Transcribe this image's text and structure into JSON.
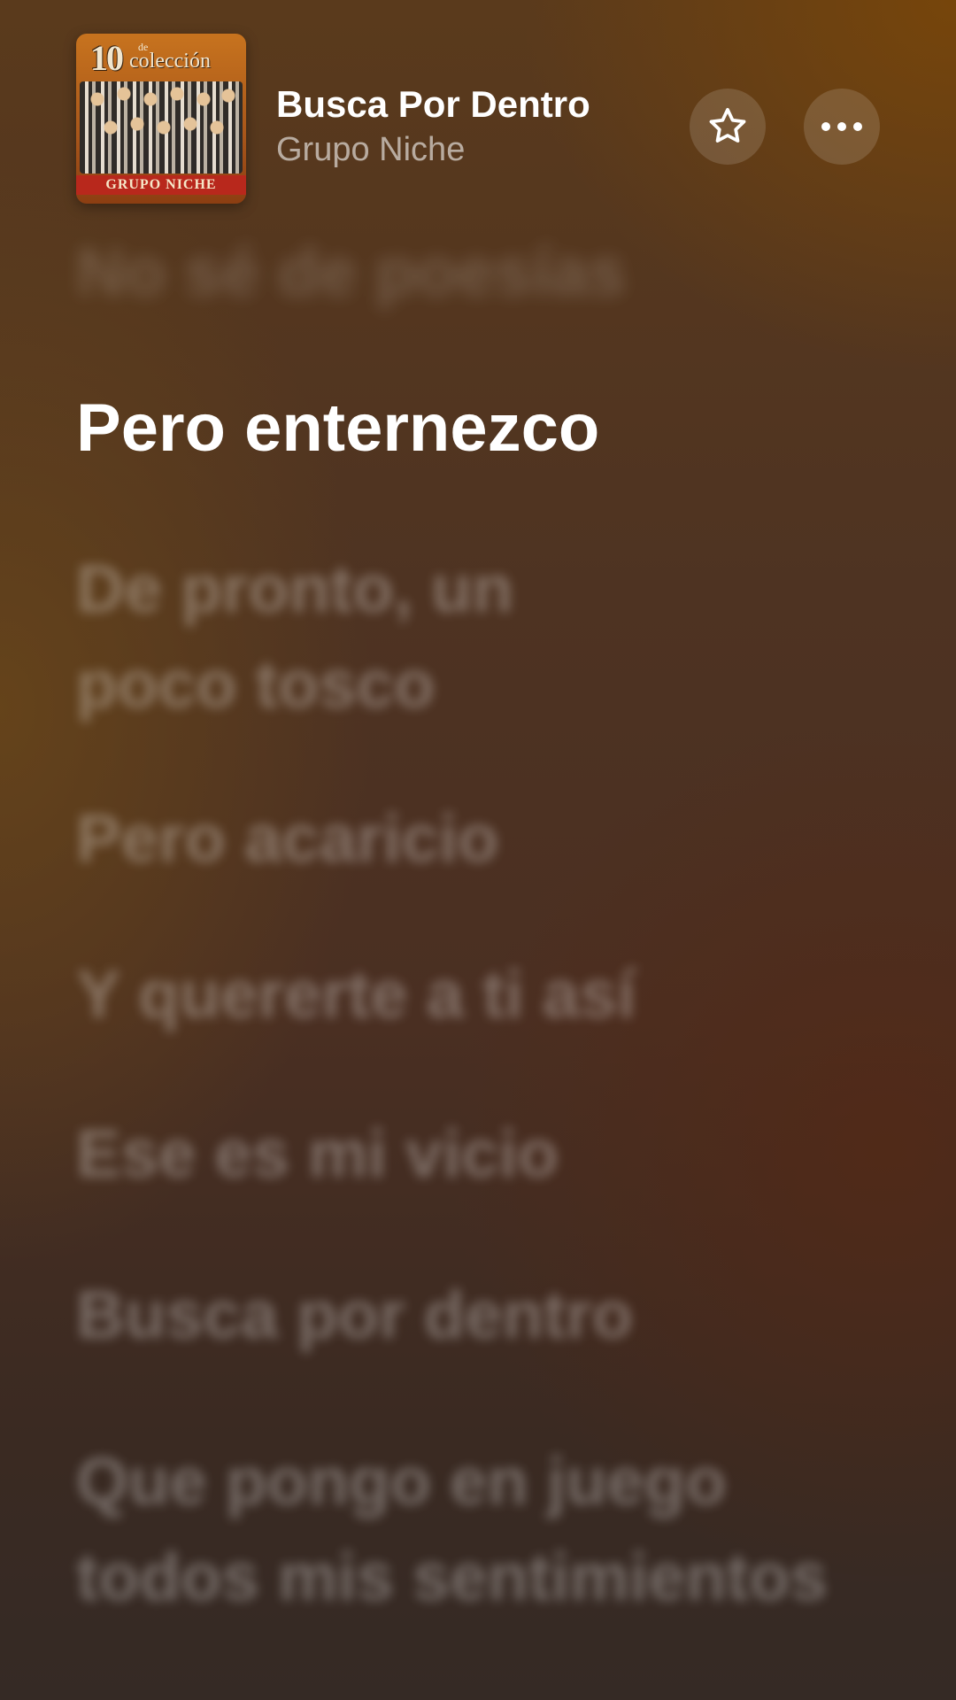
{
  "now_playing": {
    "title": "Busca Por Dentro",
    "artist": "Grupo Niche",
    "album_art": {
      "number_text": "10",
      "de_text": "de",
      "collection_text": "colección",
      "band_text": "GRUPO NICHE"
    }
  },
  "actions": {
    "favorite_icon": "star-icon",
    "more_icon": "ellipsis-icon"
  },
  "lyrics": {
    "previous": "No sé de poesías",
    "current": "Pero enternezco",
    "upcoming": [
      "De pronto, un poco tosco",
      "Pero acaricio",
      "Y quererte a ti así",
      "Ese es mi vicio",
      "Busca por dentro",
      "Que pongo en juego todos mis sentimientos"
    ]
  }
}
